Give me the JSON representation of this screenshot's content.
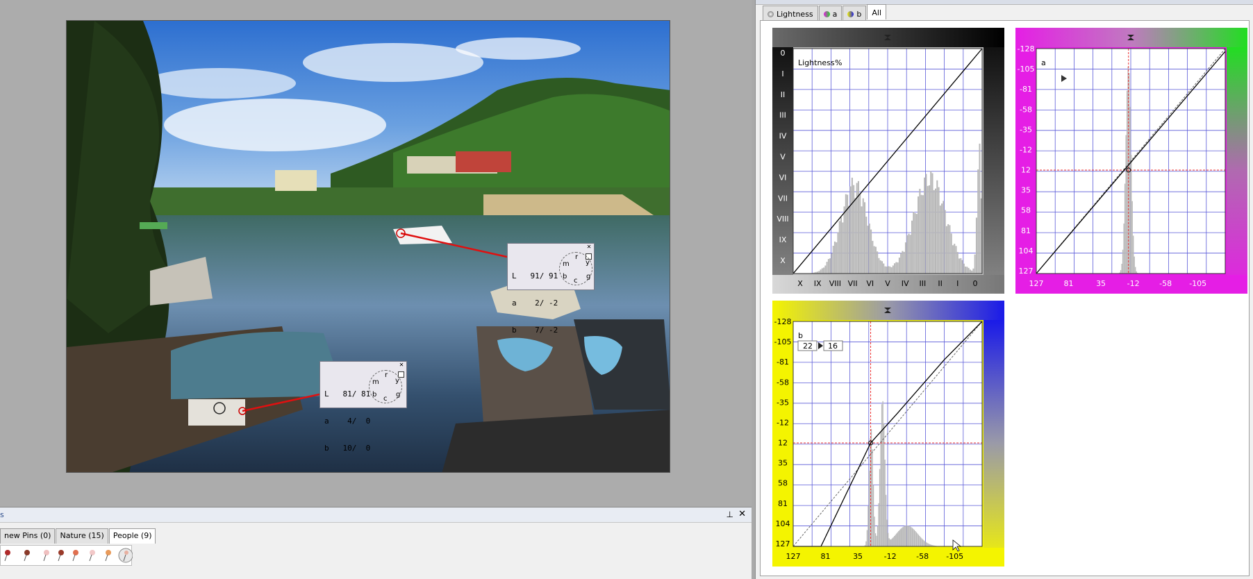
{
  "curves": {
    "tabs": [
      {
        "label": "Lightness",
        "icon": "lightness-icon",
        "active": false
      },
      {
        "label": "a",
        "icon": "a-channel-icon",
        "active": false
      },
      {
        "label": "b",
        "icon": "b-channel-icon",
        "active": false
      },
      {
        "label": "All",
        "icon": "",
        "active": true
      }
    ],
    "lightness": {
      "title": "Lightness",
      "unit": "%",
      "zones_left": [
        "0",
        "I",
        "II",
        "III",
        "IV",
        "V",
        "VI",
        "VII",
        "VIII",
        "IX",
        "X"
      ],
      "zones_bottom": [
        "X",
        "IX",
        "VIII",
        "VII",
        "VI",
        "V",
        "IV",
        "III",
        "II",
        "I",
        "0"
      ]
    },
    "a": {
      "title": "a",
      "left_ticks": [
        "-128",
        "-105",
        "-81",
        "-58",
        "-35",
        "-12",
        "12",
        "35",
        "58",
        "81",
        "104",
        "127"
      ],
      "bottom_ticks": [
        "127",
        "81",
        "35",
        "-12",
        "-58",
        "-105"
      ]
    },
    "b": {
      "title": "b",
      "input_value": "22",
      "output_value": "16",
      "left_ticks": [
        "-128",
        "-105",
        "-81",
        "-58",
        "-35",
        "-12",
        "12",
        "35",
        "58",
        "81",
        "104",
        "127"
      ],
      "bottom_ticks": [
        "127",
        "81",
        "35",
        "-12",
        "-58",
        "-105"
      ]
    }
  },
  "samplers": [
    {
      "L": "L   91/ 91",
      "a": "a    2/ -2",
      "b": "b    7/ -2",
      "close": "✕"
    },
    {
      "L": "L   81/ 81",
      "a": "a    4/  0",
      "b": "b   10/  0",
      "close": "✕"
    }
  ],
  "wheel_letters": {
    "m": "m",
    "r": "r",
    "y": "y",
    "g": "g",
    "c": "c",
    "b": "b"
  },
  "pins": {
    "title": "s",
    "tabs": [
      {
        "label": "new Pins (0)",
        "active": false
      },
      {
        "label": "Nature (15)",
        "active": false
      },
      {
        "label": "People (9)",
        "active": true
      }
    ]
  },
  "colors": {
    "grid": "#5a5ad8",
    "magenta": "#e51ee5",
    "green": "#22dd22",
    "yellow": "#f4f400",
    "blue": "#1a1ae8",
    "sampler_line": "#e01010"
  }
}
